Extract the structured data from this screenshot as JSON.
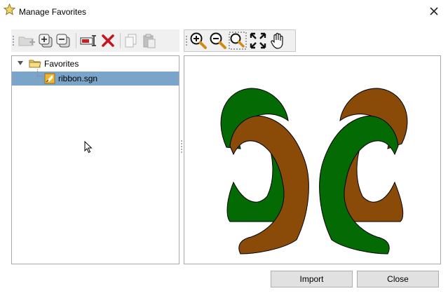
{
  "window": {
    "title": "Manage Favorites",
    "title_icon": "star-icon",
    "close_icon": "close-icon"
  },
  "left_toolbar": {
    "buttons": [
      {
        "icon": "new-folder-icon",
        "enabled": false
      },
      {
        "icon": "expand-all-icon",
        "enabled": true
      },
      {
        "icon": "collapse-all-icon",
        "enabled": true
      },
      {
        "icon": "rename-icon",
        "enabled": true
      },
      {
        "icon": "delete-icon",
        "enabled": true
      },
      {
        "icon": "copy-icon",
        "enabled": false
      },
      {
        "icon": "paste-icon",
        "enabled": false
      }
    ]
  },
  "tree": {
    "root": {
      "label": "Favorites",
      "icon": "folder-icon",
      "expanded": true
    },
    "items": [
      {
        "label": "ribbon.sgn",
        "icon": "sign-file-icon",
        "selected": true
      }
    ]
  },
  "preview_toolbar": {
    "buttons": [
      {
        "icon": "zoom-in-icon"
      },
      {
        "icon": "zoom-out-icon"
      },
      {
        "icon": "zoom-window-icon"
      },
      {
        "icon": "zoom-extents-icon"
      },
      {
        "icon": "pan-hand-icon"
      }
    ]
  },
  "preview": {
    "colors": {
      "green": "#046a04",
      "brown": "#8a4b08",
      "outline": "#000000"
    }
  },
  "buttons": {
    "import_label": "Import",
    "close_label": "Close"
  }
}
